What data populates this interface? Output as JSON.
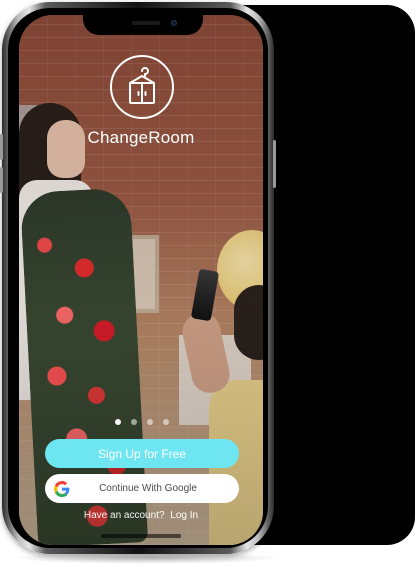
{
  "app": {
    "name": "ChangeRoom"
  },
  "logo": {
    "icon_name": "wardrobe-hanger-icon",
    "stroke_color": "#ffffff"
  },
  "pagination": {
    "total": 4,
    "active_index": 0
  },
  "actions": {
    "signup_label": "Sign Up for Free",
    "google_label": "Continue With Google",
    "google_icon_name": "google-g-icon",
    "signup_color": "#6ee6f2"
  },
  "login_prompt": {
    "question": "Have an account?",
    "link": "Log In"
  }
}
